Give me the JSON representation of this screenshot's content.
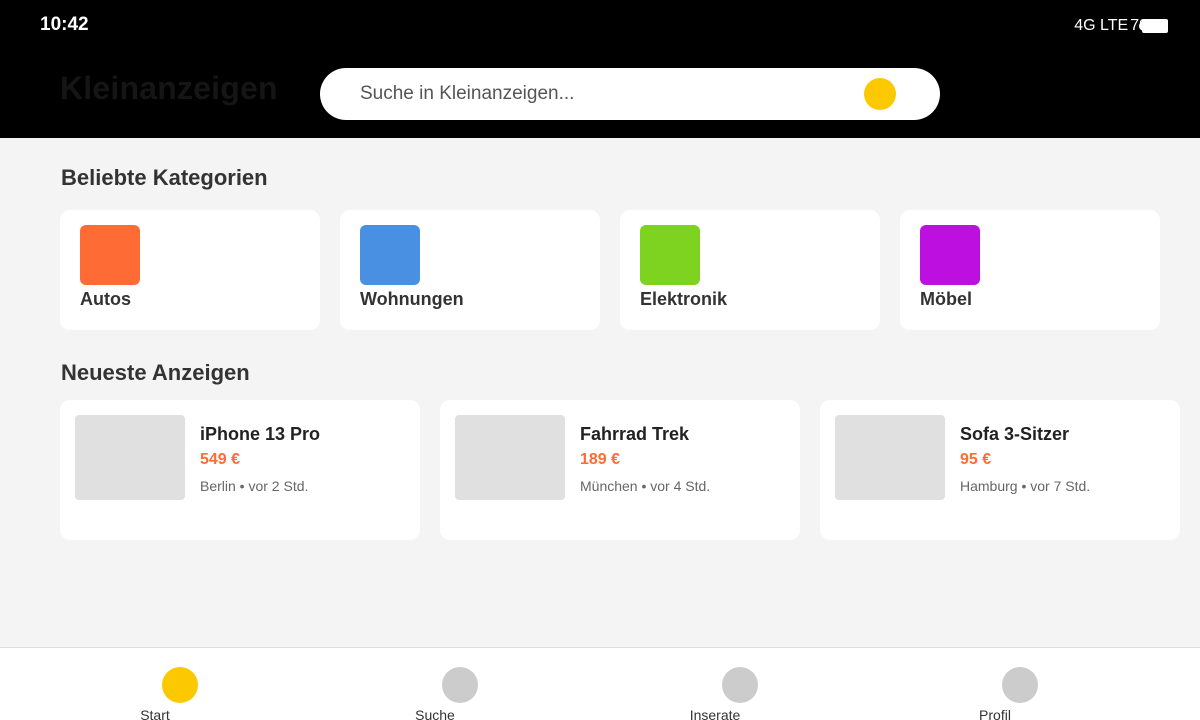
{
  "status_bar": {
    "time": "10:42",
    "network": "4G LTE",
    "battery": "79"
  },
  "header": {
    "app_title": "Kleinanzeigen"
  },
  "search": {
    "placeholder": "Suche in Kleinanzeigen...",
    "value": "",
    "icon": "search-icon",
    "icon_color": "#fcc900"
  },
  "categories": {
    "title": "Beliebte Kategorien",
    "items": [
      {
        "label": "Autos",
        "color": "#ff6b35"
      },
      {
        "label": "Wohnungen",
        "color": "#4a90e2"
      },
      {
        "label": "Elektronik",
        "color": "#7ed321"
      },
      {
        "label": "Möbel",
        "color": "#bd10e0"
      }
    ]
  },
  "latest": {
    "title": "Neueste Anzeigen",
    "items": [
      {
        "title": "iPhone 13 Pro",
        "price": "549 €",
        "location_time": "Berlin • vor 2 Std."
      },
      {
        "title": "Fahrrad Trek",
        "price": "189 €",
        "location_time": "München • vor 4 Std."
      },
      {
        "title": "Sofa 3-Sitzer",
        "price": "95 €",
        "location_time": "Hamburg • vor 7 Std."
      }
    ],
    "price_color": "#ff6b35"
  },
  "bottom_nav": {
    "active_color": "#fcc900",
    "inactive_color": "#cccccc",
    "items": [
      {
        "label": "Start",
        "icon": "home-icon",
        "active": true
      },
      {
        "label": "Suche",
        "icon": "search-icon",
        "active": false
      },
      {
        "label": "Inserate",
        "icon": "listings-icon",
        "active": false
      },
      {
        "label": "Profil",
        "icon": "profile-icon",
        "active": false
      }
    ]
  }
}
